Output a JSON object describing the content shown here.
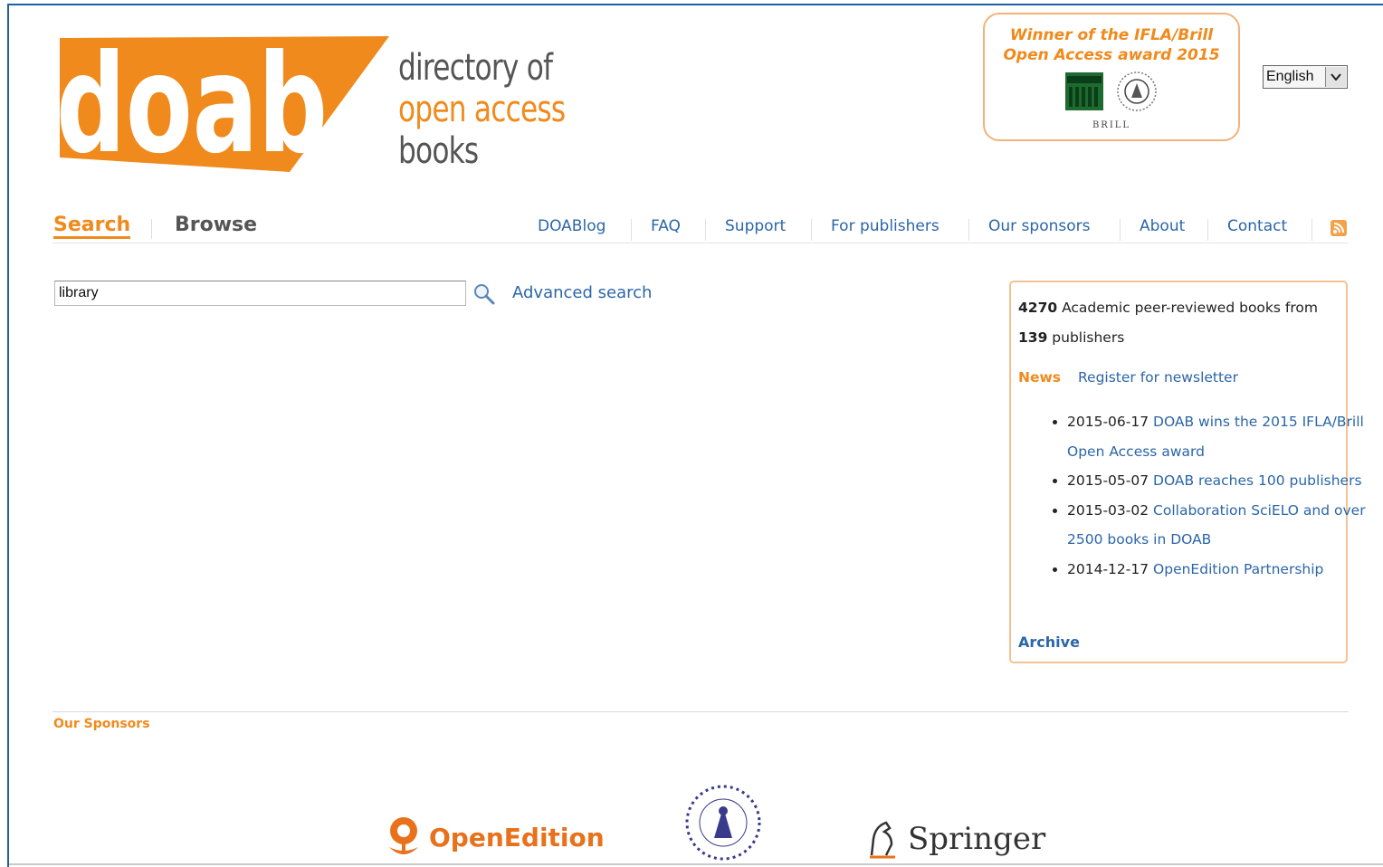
{
  "logo": {
    "mark": "doab",
    "line1": "directory of",
    "line2": "open access",
    "line3": "books"
  },
  "award": {
    "line1": "Winner of the IFLA/Brill",
    "line2": "Open Access award 2015",
    "brill": "BRILL"
  },
  "language": {
    "selected": "English"
  },
  "tabs": {
    "search": "Search",
    "browse": "Browse"
  },
  "menu": [
    "DOABlog",
    "FAQ",
    "Support",
    "For publishers",
    "Our sponsors",
    "About",
    "Contact"
  ],
  "search": {
    "value": "library",
    "advanced": "Advanced search"
  },
  "panel": {
    "books_count": "4270",
    "books_text": "Academic peer-reviewed books from",
    "publishers_count": "139",
    "publishers_text": "publishers",
    "news_label": "News",
    "newsletter_link": "Register for newsletter",
    "news": [
      {
        "date": "2015-06-17",
        "title": "DOAB wins the 2015 IFLA/Brill Open Access award"
      },
      {
        "date": "2015-05-07",
        "title": "DOAB reaches 100 publishers"
      },
      {
        "date": "2015-03-02",
        "title": "Collaboration SciELO and over 2500 books in DOAB"
      },
      {
        "date": "2014-12-17",
        "title": "OpenEdition Partnership"
      }
    ],
    "archive": "Archive"
  },
  "sponsors": {
    "title": "Our Sponsors",
    "openedition": "OpenEdition",
    "springer": "Springer"
  },
  "colors": {
    "orange": "#f08a1c",
    "link": "#2b66a8",
    "frame": "#1f5fa8"
  }
}
